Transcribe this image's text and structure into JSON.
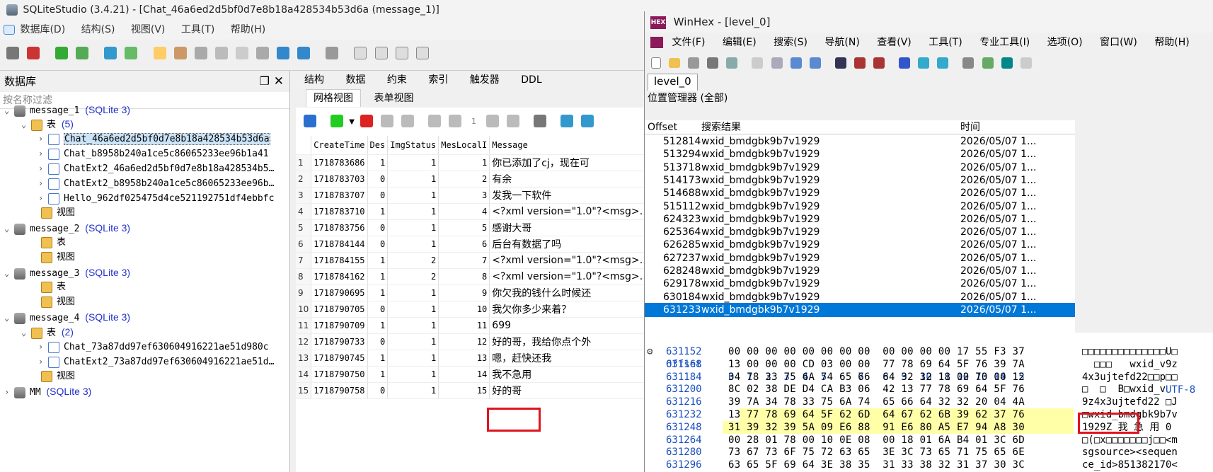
{
  "sqlite": {
    "title": "SQLiteStudio (3.4.21) - [Chat_46a6ed2d5bf0d7e8b18a428534b53d6a (message_1)]",
    "menu": [
      "数据库(D)",
      "结构(S)",
      "视图(V)",
      "工具(T)",
      "帮助(H)"
    ],
    "db_panel_title": "数据库",
    "filter_placeholder": "按名称过滤",
    "tree": [
      {
        "label": "message_1",
        "sub": "(SQLite 3)"
      },
      {
        "label": "表",
        "sub": "(5)"
      },
      {
        "label": "Chat_46a6ed2d5bf0d7e8b18a428534b53d6a"
      },
      {
        "label": "Chat_b8958b240a1ce5c86065233ee96b1a41"
      },
      {
        "label": "ChatExt2_46a6ed2d5bf0d7e8b18a428534b5…"
      },
      {
        "label": "ChatExt2_b8958b240a1ce5c86065233ee96b…"
      },
      {
        "label": "Hello_962df025475d4ce521192751df4ebbfc"
      },
      {
        "label": "视图"
      },
      {
        "label": "message_2",
        "sub": "(SQLite 3)"
      },
      {
        "label": "表"
      },
      {
        "label": "视图"
      },
      {
        "label": "message_3",
        "sub": "(SQLite 3)"
      },
      {
        "label": "表"
      },
      {
        "label": "视图"
      },
      {
        "label": "message_4",
        "sub": "(SQLite 3)"
      },
      {
        "label": "表",
        "sub": "(2)"
      },
      {
        "label": "Chat_73a87dd97ef630604916221ae51d980c"
      },
      {
        "label": "ChatExt2_73a87dd97ef630604916221ae51d…"
      },
      {
        "label": "视图"
      },
      {
        "label": "MM",
        "sub": "(SQLite 3)"
      }
    ],
    "tabs": [
      "结构",
      "数据",
      "约束",
      "索引",
      "触发器",
      "DDL"
    ],
    "subtabs": [
      "网格视图",
      "表单视图"
    ],
    "page_num": "1",
    "columns": [
      "",
      "CreateTime",
      "Des",
      "ImgStatus",
      "MesLocalI",
      "Message"
    ],
    "rows": [
      [
        "1",
        "1718783686",
        "1",
        "1",
        "1",
        "你已添加了cj，现在可"
      ],
      [
        "2",
        "1718783703",
        "0",
        "1",
        "2",
        "有余"
      ],
      [
        "3",
        "1718783707",
        "0",
        "1",
        "3",
        "发我一下软件"
      ],
      [
        "4",
        "1718783710",
        "1",
        "1",
        "4",
        "<?xml version=\"1.0\"?<msg>…"
      ],
      [
        "5",
        "1718783756",
        "0",
        "1",
        "5",
        "感谢大哥"
      ],
      [
        "6",
        "1718784144",
        "0",
        "1",
        "6",
        "后台有数据了吗"
      ],
      [
        "7",
        "1718784155",
        "1",
        "2",
        "7",
        "<?xml version=\"1.0\"?<msg>…"
      ],
      [
        "8",
        "1718784162",
        "1",
        "2",
        "8",
        "<?xml version=\"1.0\"?<msg>…"
      ],
      [
        "9",
        "1718790695",
        "1",
        "1",
        "9",
        "你欠我的钱什么时候还"
      ],
      [
        "10",
        "1718790705",
        "0",
        "1",
        "10",
        "我欠你多少来着？"
      ],
      [
        "11",
        "1718790709",
        "1",
        "1",
        "11",
        "699"
      ],
      [
        "12",
        "1718790733",
        "0",
        "1",
        "12",
        "好的哥，我给你点个外"
      ],
      [
        "13",
        "1718790745",
        "1",
        "1",
        "13",
        "嗯，赶快还我"
      ],
      [
        "14",
        "1718790750",
        "1",
        "1",
        "14",
        "我不急用"
      ],
      [
        "15",
        "1718790758",
        "0",
        "1",
        "15",
        "好的哥"
      ]
    ]
  },
  "winhex": {
    "title": "WinHex - [level_0]",
    "logo": "HEX",
    "menu": [
      "文件(F)",
      "编辑(E)",
      "搜索(S)",
      "导航(N)",
      "查看(V)",
      "工具(T)",
      "专业工具(I)",
      "选项(O)",
      "窗口(W)",
      "帮助(H)"
    ],
    "tab": "level_0",
    "pos_manager": "位置管理器 (全部)",
    "list_headers": [
      "Offset",
      "搜索结果",
      "时间"
    ],
    "results": [
      [
        "512814",
        "wxid_bmdgbk9b7v1929",
        "2026/05/07  1..."
      ],
      [
        "513294",
        "wxid_bmdgbk9b7v1929",
        "2026/05/07  1..."
      ],
      [
        "513718",
        "wxid_bmdgbk9b7v1929",
        "2026/05/07  1..."
      ],
      [
        "514173",
        "wxid_bmdgbk9b7v1929",
        "2026/05/07  1..."
      ],
      [
        "514688",
        "wxid_bmdgbk9b7v1929",
        "2026/05/07  1..."
      ],
      [
        "515112",
        "wxid_bmdgbk9b7v1929",
        "2026/05/07  1..."
      ],
      [
        "624323",
        "wxid_bmdgbk9b7v1929",
        "2026/05/07  1..."
      ],
      [
        "625364",
        "wxid_bmdgbk9b7v1929",
        "2026/05/07  1..."
      ],
      [
        "626285",
        "wxid_bmdgbk9b7v1929",
        "2026/05/07  1..."
      ],
      [
        "627237",
        "wxid_bmdgbk9b7v1929",
        "2026/05/07  1..."
      ],
      [
        "628248",
        "wxid_bmdgbk9b7v1929",
        "2026/05/07  1..."
      ],
      [
        "629178",
        "wxid_bmdgbk9b7v1929",
        "2026/05/07  1..."
      ],
      [
        "630184",
        "wxid_bmdgbk9b7v1929",
        "2026/05/07  1..."
      ],
      [
        "631233",
        "wxid_bmdgbk9b7v1929",
        "2026/05/07  1..."
      ]
    ],
    "hex_header_offset": "Offset",
    "hex_header_cols": "0  1  2  3  4  5  6  7   8  9  10 11 12 13 14 15",
    "encoding": "UTF-8",
    "hex_rows": [
      [
        "631152",
        "00 00 00 00 00 00 00 00  00 00 00 00 17 55 F3 37",
        "□□□□□□□□□□□□□□U□"
      ],
      [
        "631168",
        "13 00 00 00 CD 03 00 00  77 78 69 64 5F 76 39 7A",
        "  □□□   wxid_v9z"
      ],
      [
        "631184",
        "34 78 33 75 6A 74 65 66  64 32 32 18 00 70 00 12",
        "4x3ujtefd22□□p□□"
      ],
      [
        "631200",
        "8C 02 38 DE D4 CA B3 06  42 13 77 78 69 64 5F 76",
        "□  □  B□wxid_v"
      ],
      [
        "631216",
        "39 7A 34 78 33 75 6A 74  65 66 64 32 32 20 04 4A",
        "9z4x3ujtefd22 □J"
      ],
      [
        "631232",
        "13 77 78 69 64 5F 62 6D  64 67 62 6B 39 62 37 76",
        "□wxid_bmdgbk9b7v"
      ],
      [
        "631248",
        "31 39 32 39 5A 09 E6 88  91 E6 80 A5 E7 94 A8 30",
        "1929Z 我 急 用 0"
      ],
      [
        "631264",
        "00 28 01 78 00 10 0E 08  00 18 01 6A B4 01 3C 6D",
        "□(□x□□□□□□□j□□<m"
      ],
      [
        "631280",
        "73 67 73 6F 75 72 63 65  3E 3C 73 65 71 75 65 6E",
        "sgsource><sequen"
      ],
      [
        "631296",
        "63 65 5F 69 64 3E 38 35  31 33 38 32 31 37 30 3C",
        "ce_id>851382170<"
      ]
    ]
  },
  "colors": {
    "accent": "#0078d7",
    "highlight": "#e0141e",
    "link": "#2233cc",
    "hex_offset": "#1a4fc0"
  }
}
